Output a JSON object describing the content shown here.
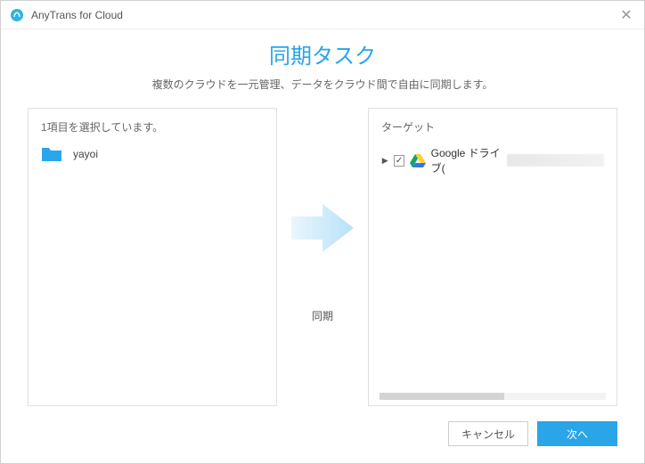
{
  "window": {
    "title": "AnyTrans for Cloud"
  },
  "header": {
    "main_title": "同期タスク",
    "subtitle": "複数のクラウドを一元管理、データをクラウド間で自由に同期します。"
  },
  "source_panel": {
    "header": "1項目を選択しています。",
    "items": [
      {
        "name": "yayoi"
      }
    ]
  },
  "center": {
    "sync_label": "同期"
  },
  "target_panel": {
    "header": "ターゲット",
    "items": [
      {
        "name": "Google ドライブ(",
        "checked": true
      }
    ]
  },
  "footer": {
    "cancel": "キャンセル",
    "next": "次へ"
  }
}
